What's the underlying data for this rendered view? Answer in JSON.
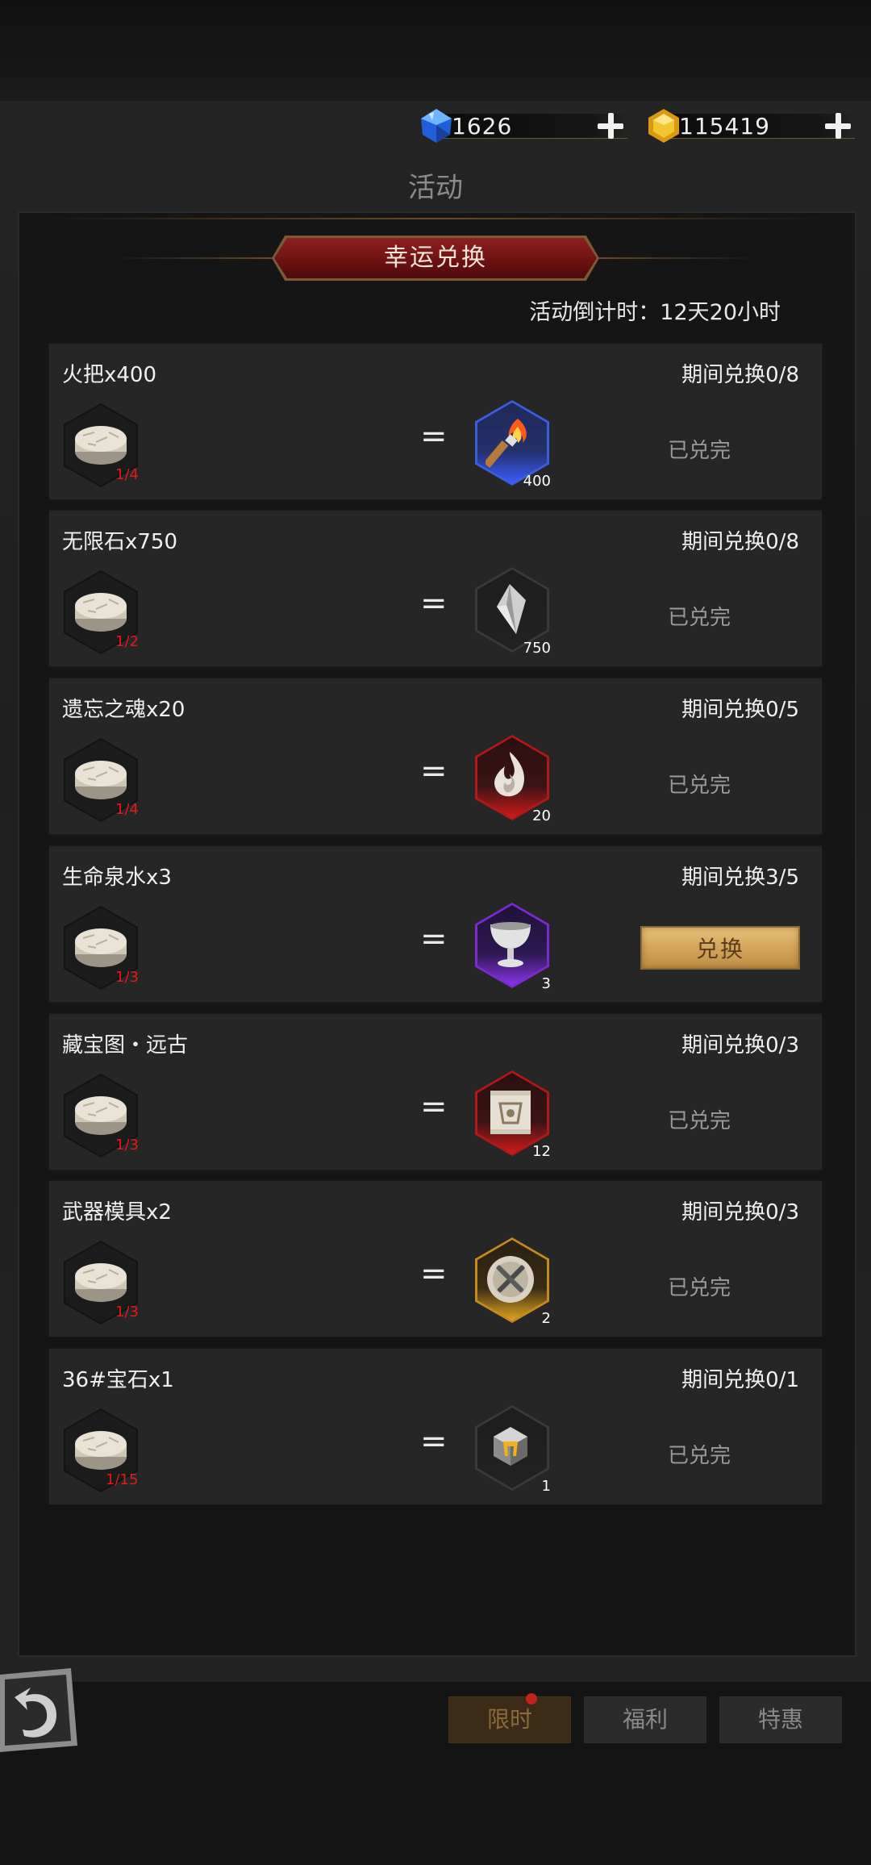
{
  "currency": {
    "diamond": {
      "icon": "blue-diamond-icon",
      "value": "1626"
    },
    "gold": {
      "icon": "gold-gem-icon",
      "value": "115419"
    }
  },
  "page_title": "活动",
  "banner": "幸运兑换",
  "countdown": "活动倒计时：12天20小时",
  "cost_icon": "stone-token-icon",
  "equals_sign": "=",
  "exchanges": [
    {
      "name": "火把x400",
      "limit": "期间兑换0/8",
      "cost_count": "1/4",
      "reward_icon": "torch-icon",
      "reward_qty": "400",
      "status": "已兑完",
      "frame": "blue"
    },
    {
      "name": "无限石x750",
      "limit": "期间兑换0/8",
      "cost_count": "1/2",
      "reward_icon": "crystal-shard-icon",
      "reward_qty": "750",
      "status": "已兑完",
      "frame": "plain"
    },
    {
      "name": "遗忘之魂x20",
      "limit": "期间兑换0/5",
      "cost_count": "1/4",
      "reward_icon": "soul-flame-icon",
      "reward_qty": "20",
      "status": "已兑完",
      "frame": "red"
    },
    {
      "name": "生命泉水x3",
      "limit": "期间兑换3/5",
      "cost_count": "1/3",
      "reward_icon": "chalice-icon",
      "reward_qty": "3",
      "status": "兑换",
      "frame": "purple"
    },
    {
      "name": "藏宝图・远古",
      "limit": "期间兑换0/3",
      "cost_count": "1/3",
      "reward_icon": "treasure-map-icon",
      "reward_qty": "12",
      "status": "已兑完",
      "frame": "red"
    },
    {
      "name": "武器模具x2",
      "limit": "期间兑换0/3",
      "cost_count": "1/3",
      "reward_icon": "weapon-mold-icon",
      "reward_qty": "2",
      "status": "已兑完",
      "frame": "gold"
    },
    {
      "name": "36#宝石x1",
      "limit": "期间兑换0/1",
      "cost_count": "1/15",
      "reward_icon": "gem-cube-icon",
      "reward_qty": "1",
      "status": "已兑完",
      "frame": "plain"
    }
  ],
  "colors": {
    "accent_red": "#8e1f1f",
    "count_red": "#e01b1b",
    "button_gold": "#d3a45a"
  },
  "bottom_tabs": [
    {
      "label": "限时",
      "active": true
    },
    {
      "label": "福利",
      "active": false
    },
    {
      "label": "特惠",
      "active": false
    }
  ],
  "back_icon": "back-arrow-icon"
}
